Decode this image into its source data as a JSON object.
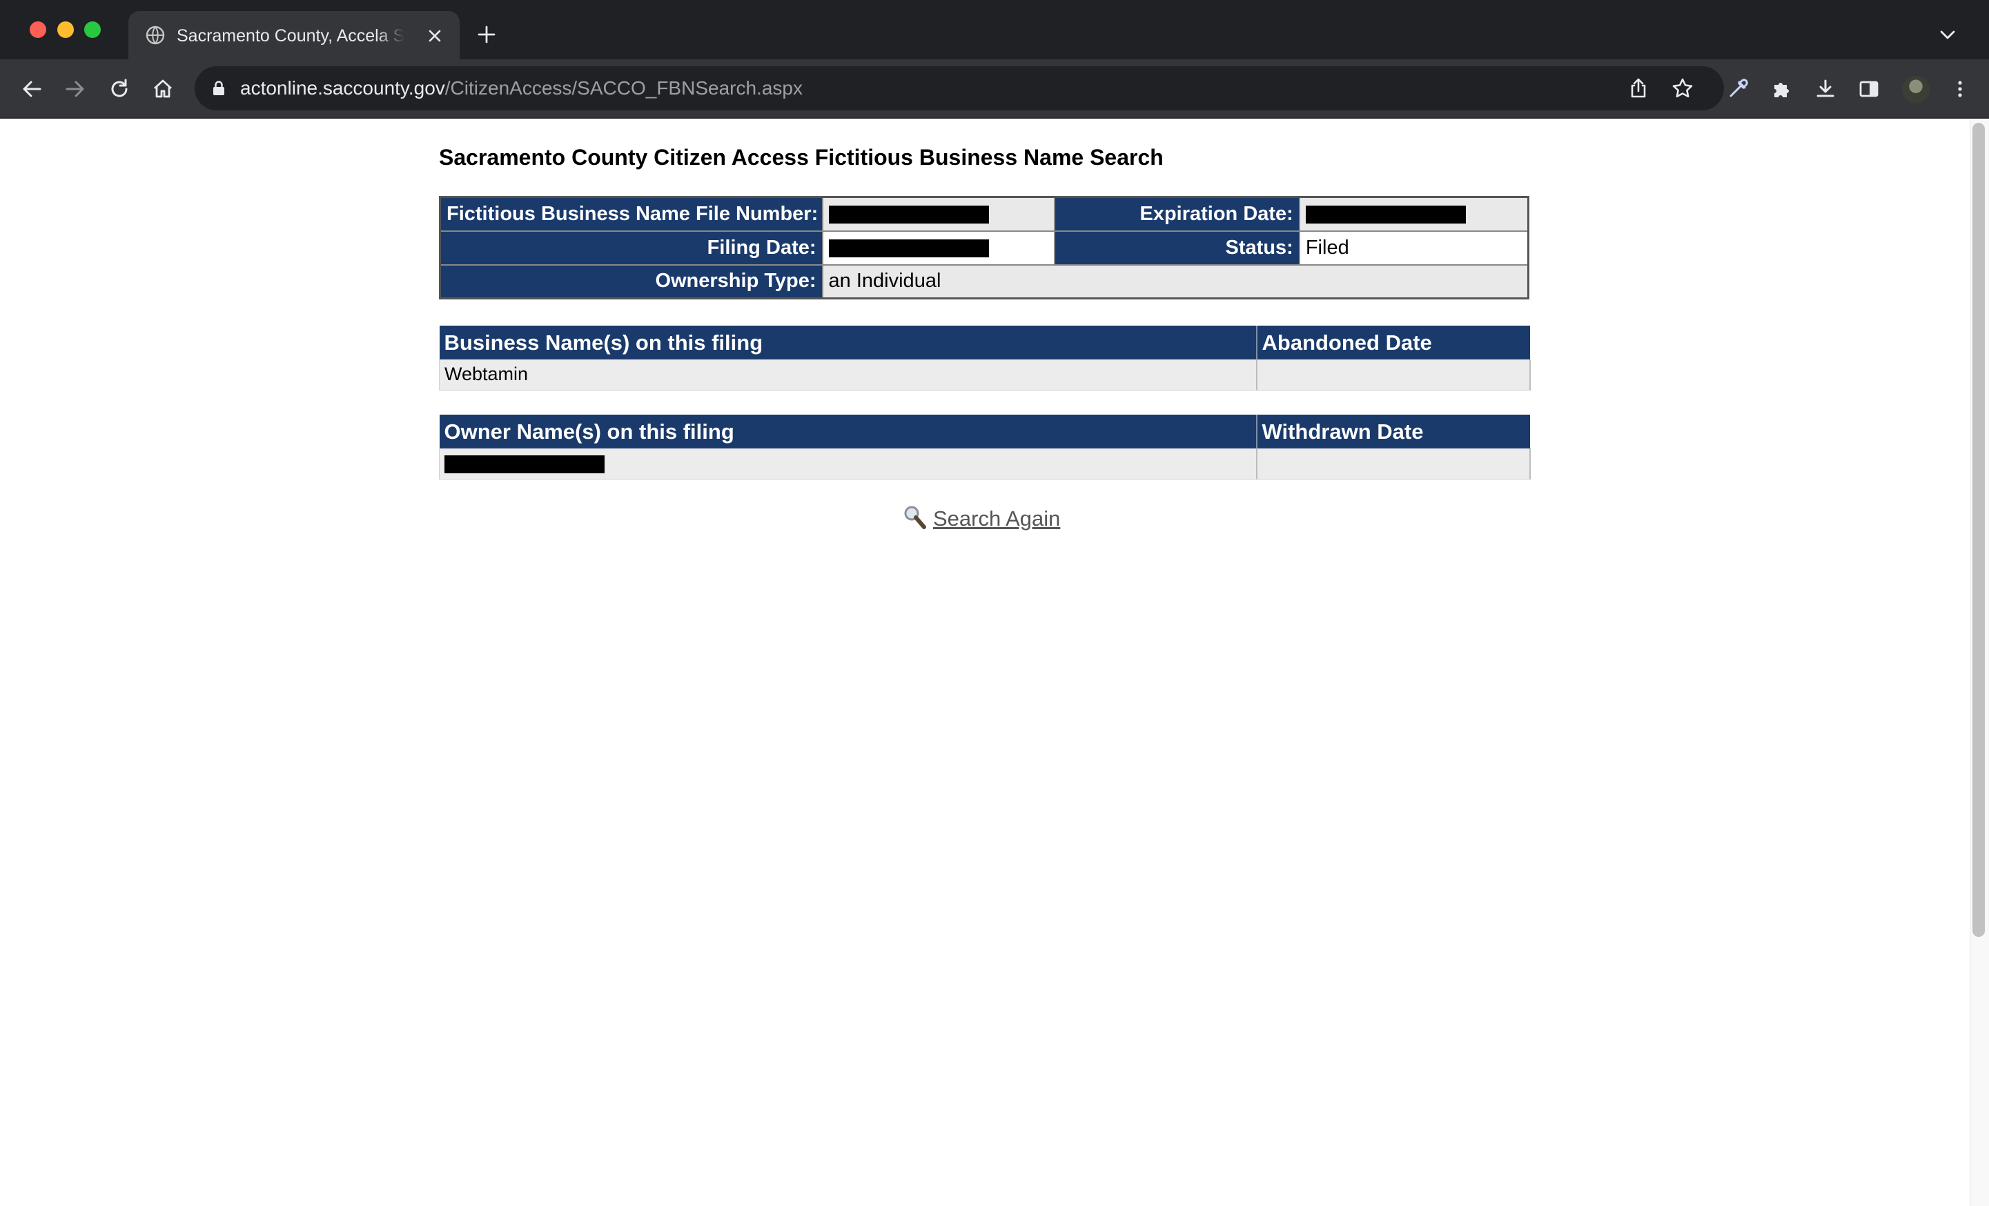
{
  "browser": {
    "tab_title": "Sacramento County, Accela Search",
    "url_host": "actonline.saccounty.gov",
    "url_path": "/CitizenAccess/SACCO_FBNSearch.aspx"
  },
  "page": {
    "title": "Sacramento County Citizen Access Fictitious Business Name Search"
  },
  "filing_info": {
    "file_number_label": "Fictitious Business Name File Number:",
    "file_number_value": "[redacted]",
    "expiration_label": "Expiration Date:",
    "expiration_value": "[redacted]",
    "filing_date_label": "Filing Date:",
    "filing_date_value": "[redacted]",
    "status_label": "Status:",
    "status_value": "Filed",
    "ownership_label": "Ownership Type:",
    "ownership_value": "an Individual"
  },
  "business_names": {
    "headers": [
      "Business Name(s) on this filing",
      "Abandoned Date"
    ],
    "rows": [
      {
        "name": "Webtamin",
        "date": ""
      }
    ]
  },
  "owner_names": {
    "headers": [
      "Owner Name(s) on this filing",
      "Withdrawn Date"
    ],
    "rows": [
      {
        "name": "[redacted]",
        "date": ""
      }
    ]
  },
  "actions": {
    "search_again_label": " Search Again"
  },
  "icons": {
    "search_again": "magnifier-icon"
  },
  "colors": {
    "header_bg": "#1a3a6b",
    "value_bg": "#e9e9e9"
  }
}
